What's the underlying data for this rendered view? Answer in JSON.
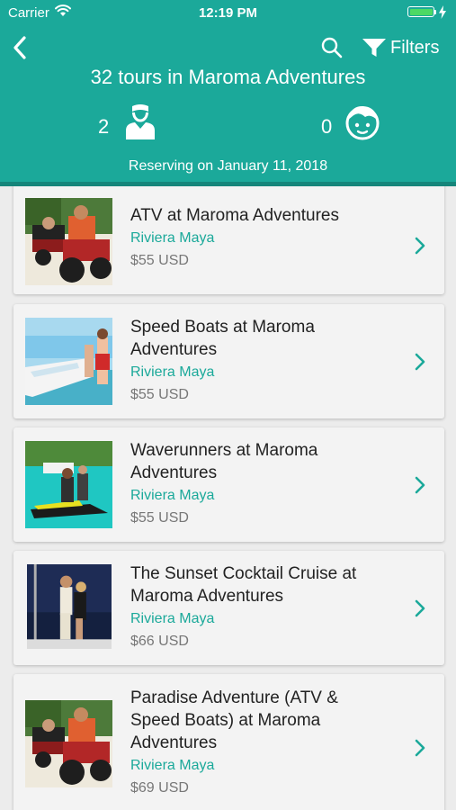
{
  "status": {
    "carrier": "Carrier",
    "time": "12:19 PM"
  },
  "header": {
    "title": "32 tours in Maroma Adventures",
    "filters_label": "Filters",
    "adults_count": "2",
    "children_count": "0",
    "reserving_text": "Reserving on January 11, 2018"
  },
  "icons": {
    "back": "chevron-left-icon",
    "search": "search-icon",
    "filter": "filter-funnel-icon",
    "adult": "adult-person-icon",
    "child": "child-face-icon",
    "row_chevron": "chevron-right-icon"
  },
  "colors": {
    "accent": "#1ba99a",
    "accent_dark": "#15857a",
    "background": "#ececec",
    "card": "#f3f3f3"
  },
  "tours": [
    {
      "name": "ATV at Maroma Adventures",
      "location": "Riviera Maya",
      "price": "$55 USD",
      "photo": "atv-riders-photo"
    },
    {
      "name": "Speed Boats at Maroma Adventures",
      "location": "Riviera Maya",
      "price": "$55 USD",
      "photo": "speed-boat-photo"
    },
    {
      "name": "Waverunners at Maroma Adventures",
      "location": "Riviera Maya",
      "price": "$55 USD",
      "photo": "waverunner-photo"
    },
    {
      "name": "The Sunset Cocktail Cruise at Maroma Adventures",
      "location": "Riviera Maya",
      "price": "$66 USD",
      "photo": "sunset-cruise-couple-photo"
    },
    {
      "name": "Paradise Adventure (ATV & Speed Boats) at Maroma Adventures",
      "location": "Riviera Maya",
      "price": "$69 USD",
      "photo": "atv-riders-photo"
    }
  ]
}
